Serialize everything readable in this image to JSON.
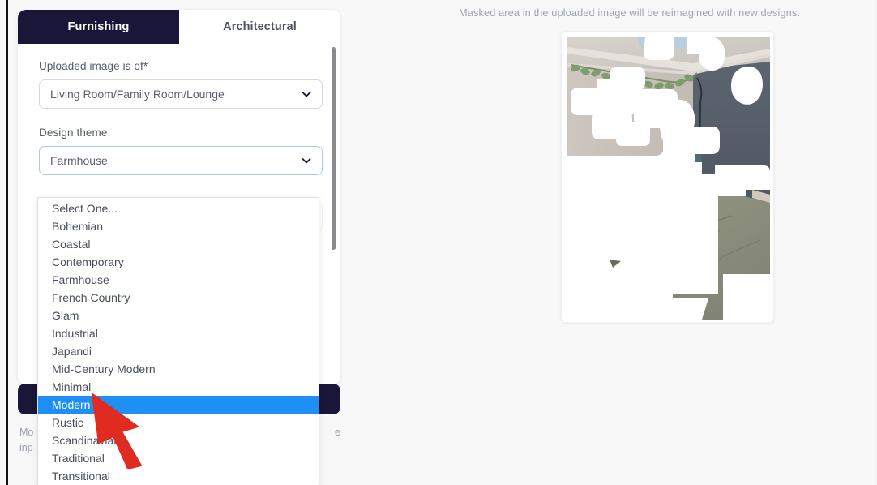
{
  "panel": {
    "tabs": [
      {
        "label": "Furnishing",
        "active": true
      },
      {
        "label": "Architectural",
        "active": false
      }
    ],
    "fields": [
      {
        "label": "Uploaded image is of*",
        "value": "Living Room/Family Room/Lounge",
        "focused": false
      },
      {
        "label": "Design theme",
        "value": "Farmhouse",
        "focused": true
      }
    ],
    "submit_label": "",
    "helper_text_left_fragment": "Mo",
    "helper_text_left_fragment2": "inp",
    "helper_text_right_fragment": "e"
  },
  "dropdown": {
    "selected": "Modern",
    "options": [
      "Select One...",
      "Bohemian",
      "Coastal",
      "Contemporary",
      "Farmhouse",
      "French Country",
      "Glam",
      "Industrial",
      "Japandi",
      "Mid-Century Modern",
      "Minimal",
      "Modern",
      "Rustic",
      "Scandinavian",
      "Traditional",
      "Transitional"
    ]
  },
  "preview": {
    "caption": "Masked area in the uploaded image will be reimagined with new designs."
  },
  "colors": {
    "tab_active_bg": "#191638",
    "highlight_blue": "#1e90f5",
    "pointer_red": "#e02b20",
    "page_bg": "#f8f8f9",
    "muted_text": "#9aa0ad"
  },
  "icons": {
    "chevron": "chevron-down-icon",
    "pointer": "arrow-pointer-icon"
  }
}
